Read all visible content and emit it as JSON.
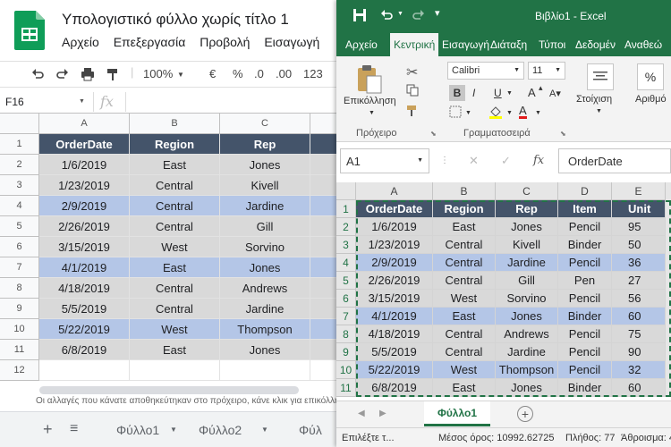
{
  "gs": {
    "title": "Υπολογιστικό φύλλο χωρίς τίτλο 1",
    "menu": [
      "Αρχείο",
      "Επεξεργασία",
      "Προβολή",
      "Εισαγωγή"
    ],
    "toolbar": {
      "zoom": "100%",
      "currency": "€",
      "percent": "%",
      "decimals": ".0",
      "decimals2": ".00",
      "format": "123"
    },
    "cell_ref": "F16",
    "fx": "fx",
    "columns": [
      "A",
      "B",
      "C"
    ],
    "headers": [
      "OrderDate",
      "Region",
      "Rep"
    ],
    "rows": [
      [
        "1/6/2019",
        "East",
        "Jones"
      ],
      [
        "1/23/2019",
        "Central",
        "Kivell"
      ],
      [
        "2/9/2019",
        "Central",
        "Jardine"
      ],
      [
        "2/26/2019",
        "Central",
        "Gill"
      ],
      [
        "3/15/2019",
        "West",
        "Sorvino"
      ],
      [
        "4/1/2019",
        "East",
        "Jones"
      ],
      [
        "4/18/2019",
        "Central",
        "Andrews"
      ],
      [
        "5/5/2019",
        "Central",
        "Jardine"
      ],
      [
        "5/22/2019",
        "West",
        "Thompson"
      ],
      [
        "6/8/2019",
        "East",
        "Jones"
      ]
    ],
    "row_numbers": [
      "1",
      "2",
      "3",
      "4",
      "5",
      "6",
      "7",
      "8",
      "9",
      "10",
      "11",
      "12"
    ],
    "note": "Οι αλλαγές που κάνατε αποθηκεύτηκαν στο πρόχειρο, κάνε κλικ για επικόλληση",
    "sheets": [
      "Φύλλο1",
      "Φύλλο2",
      "Φύλ"
    ]
  },
  "xl": {
    "title": "Βιβλίο1 - Excel",
    "tabs": [
      "Αρχείο",
      "Κεντρική",
      "Εισαγωγή",
      "Διάταξη",
      "Τύποι",
      "Δεδομέν",
      "Αναθεώ"
    ],
    "ribbon": {
      "paste": "Επικόλληση",
      "clipboard": "Πρόχειρο",
      "font_name": "Calibri",
      "font_size": "11",
      "bold": "B",
      "italic": "I",
      "underline": "U",
      "grow": "A",
      "font_group": "Γραμματοσειρά",
      "alignment": "Στοίχιση",
      "number": "Αριθμό"
    },
    "name_box": "A1",
    "formula": "OrderDate",
    "fx": "fx",
    "columns": [
      "A",
      "B",
      "C",
      "D",
      "E"
    ],
    "headers": [
      "OrderDate",
      "Region",
      "Rep",
      "Item",
      "Unit"
    ],
    "rows": [
      [
        "1/6/2019",
        "East",
        "Jones",
        "Pencil",
        "95"
      ],
      [
        "1/23/2019",
        "Central",
        "Kivell",
        "Binder",
        "50"
      ],
      [
        "2/9/2019",
        "Central",
        "Jardine",
        "Pencil",
        "36"
      ],
      [
        "2/26/2019",
        "Central",
        "Gill",
        "Pen",
        "27"
      ],
      [
        "3/15/2019",
        "West",
        "Sorvino",
        "Pencil",
        "56"
      ],
      [
        "4/1/2019",
        "East",
        "Jones",
        "Binder",
        "60"
      ],
      [
        "4/18/2019",
        "Central",
        "Andrews",
        "Pencil",
        "75"
      ],
      [
        "5/5/2019",
        "Central",
        "Jardine",
        "Pencil",
        "90"
      ],
      [
        "5/22/2019",
        "West",
        "Thompson",
        "Pencil",
        "32"
      ],
      [
        "6/8/2019",
        "East",
        "Jones",
        "Binder",
        "60"
      ]
    ],
    "row_numbers": [
      "1",
      "2",
      "3",
      "4",
      "5",
      "6",
      "7",
      "8",
      "9",
      "10",
      "11"
    ],
    "sheet": "Φύλλο1",
    "status": {
      "mode": "Επιλέξτε τ...",
      "average": "Μέσος όρος: 10992.62725",
      "count": "Πλήθος: 77",
      "sum": "Άθροισμα: 4"
    }
  },
  "colors": {
    "excel_green": "#217346",
    "sheets_green": "#0f9d58",
    "header_dark": "#44546a",
    "row_blue": "#b4c6e7",
    "row_gray": "#d9d9d9"
  }
}
